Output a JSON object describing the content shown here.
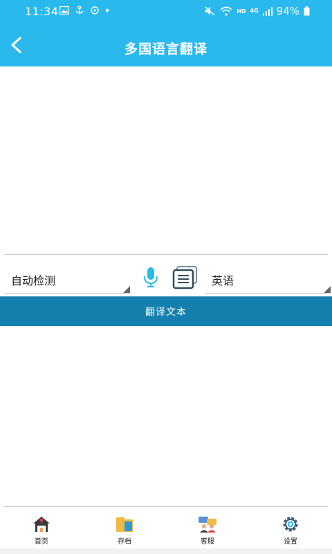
{
  "status_bar": {
    "time": "11:34",
    "network": "4G",
    "hd": "HD",
    "battery": "94%"
  },
  "header": {
    "title": "多国语言翻译",
    "back_icon": "chevron-left-icon"
  },
  "input": {
    "value": "",
    "placeholder": ""
  },
  "languages": {
    "source": "自动检测",
    "target": "英语"
  },
  "translate_button": {
    "label": "翻译文本"
  },
  "output": {
    "value": ""
  },
  "bottom_nav": {
    "items": [
      {
        "label": "首页",
        "icon": "home-icon"
      },
      {
        "label": "存档",
        "icon": "folder-icon"
      },
      {
        "label": "客服",
        "icon": "customer-service-icon"
      },
      {
        "label": "设置",
        "icon": "gear-icon"
      }
    ]
  },
  "colors": {
    "header": "#2ab9ec",
    "translate_button": "#1580ae",
    "mic": "#2ab9ec"
  }
}
